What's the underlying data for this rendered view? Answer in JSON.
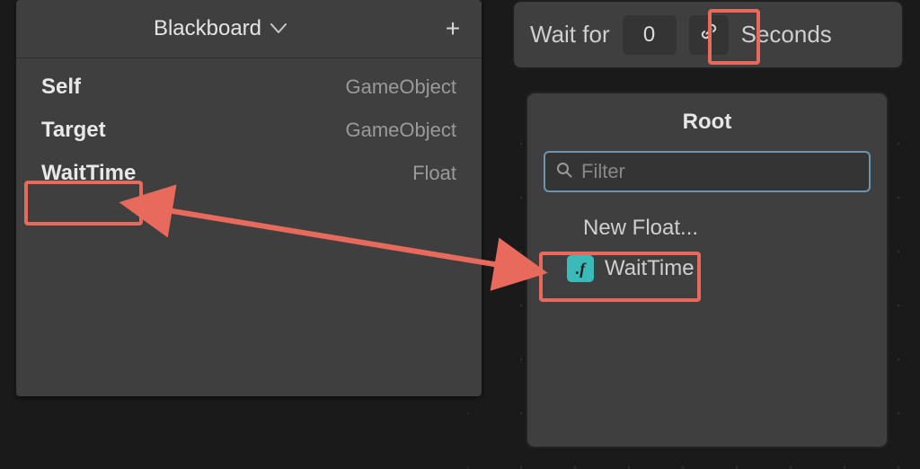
{
  "blackboard": {
    "title": "Blackboard",
    "rows": [
      {
        "name": "Self",
        "type": "GameObject"
      },
      {
        "name": "Target",
        "type": "GameObject"
      },
      {
        "name": "WaitTime",
        "type": "Float"
      }
    ]
  },
  "wait_bar": {
    "prefix": "Wait for",
    "value": "0",
    "suffix": "Seconds"
  },
  "popup": {
    "title": "Root",
    "filter_placeholder": "Filter",
    "new_float_label": "New Float...",
    "item_label": "WaitTime",
    "float_icon_text": ".f"
  },
  "annotations": {
    "arrow_color": "#e86a5c",
    "highlight_color": "#e86a5c"
  }
}
